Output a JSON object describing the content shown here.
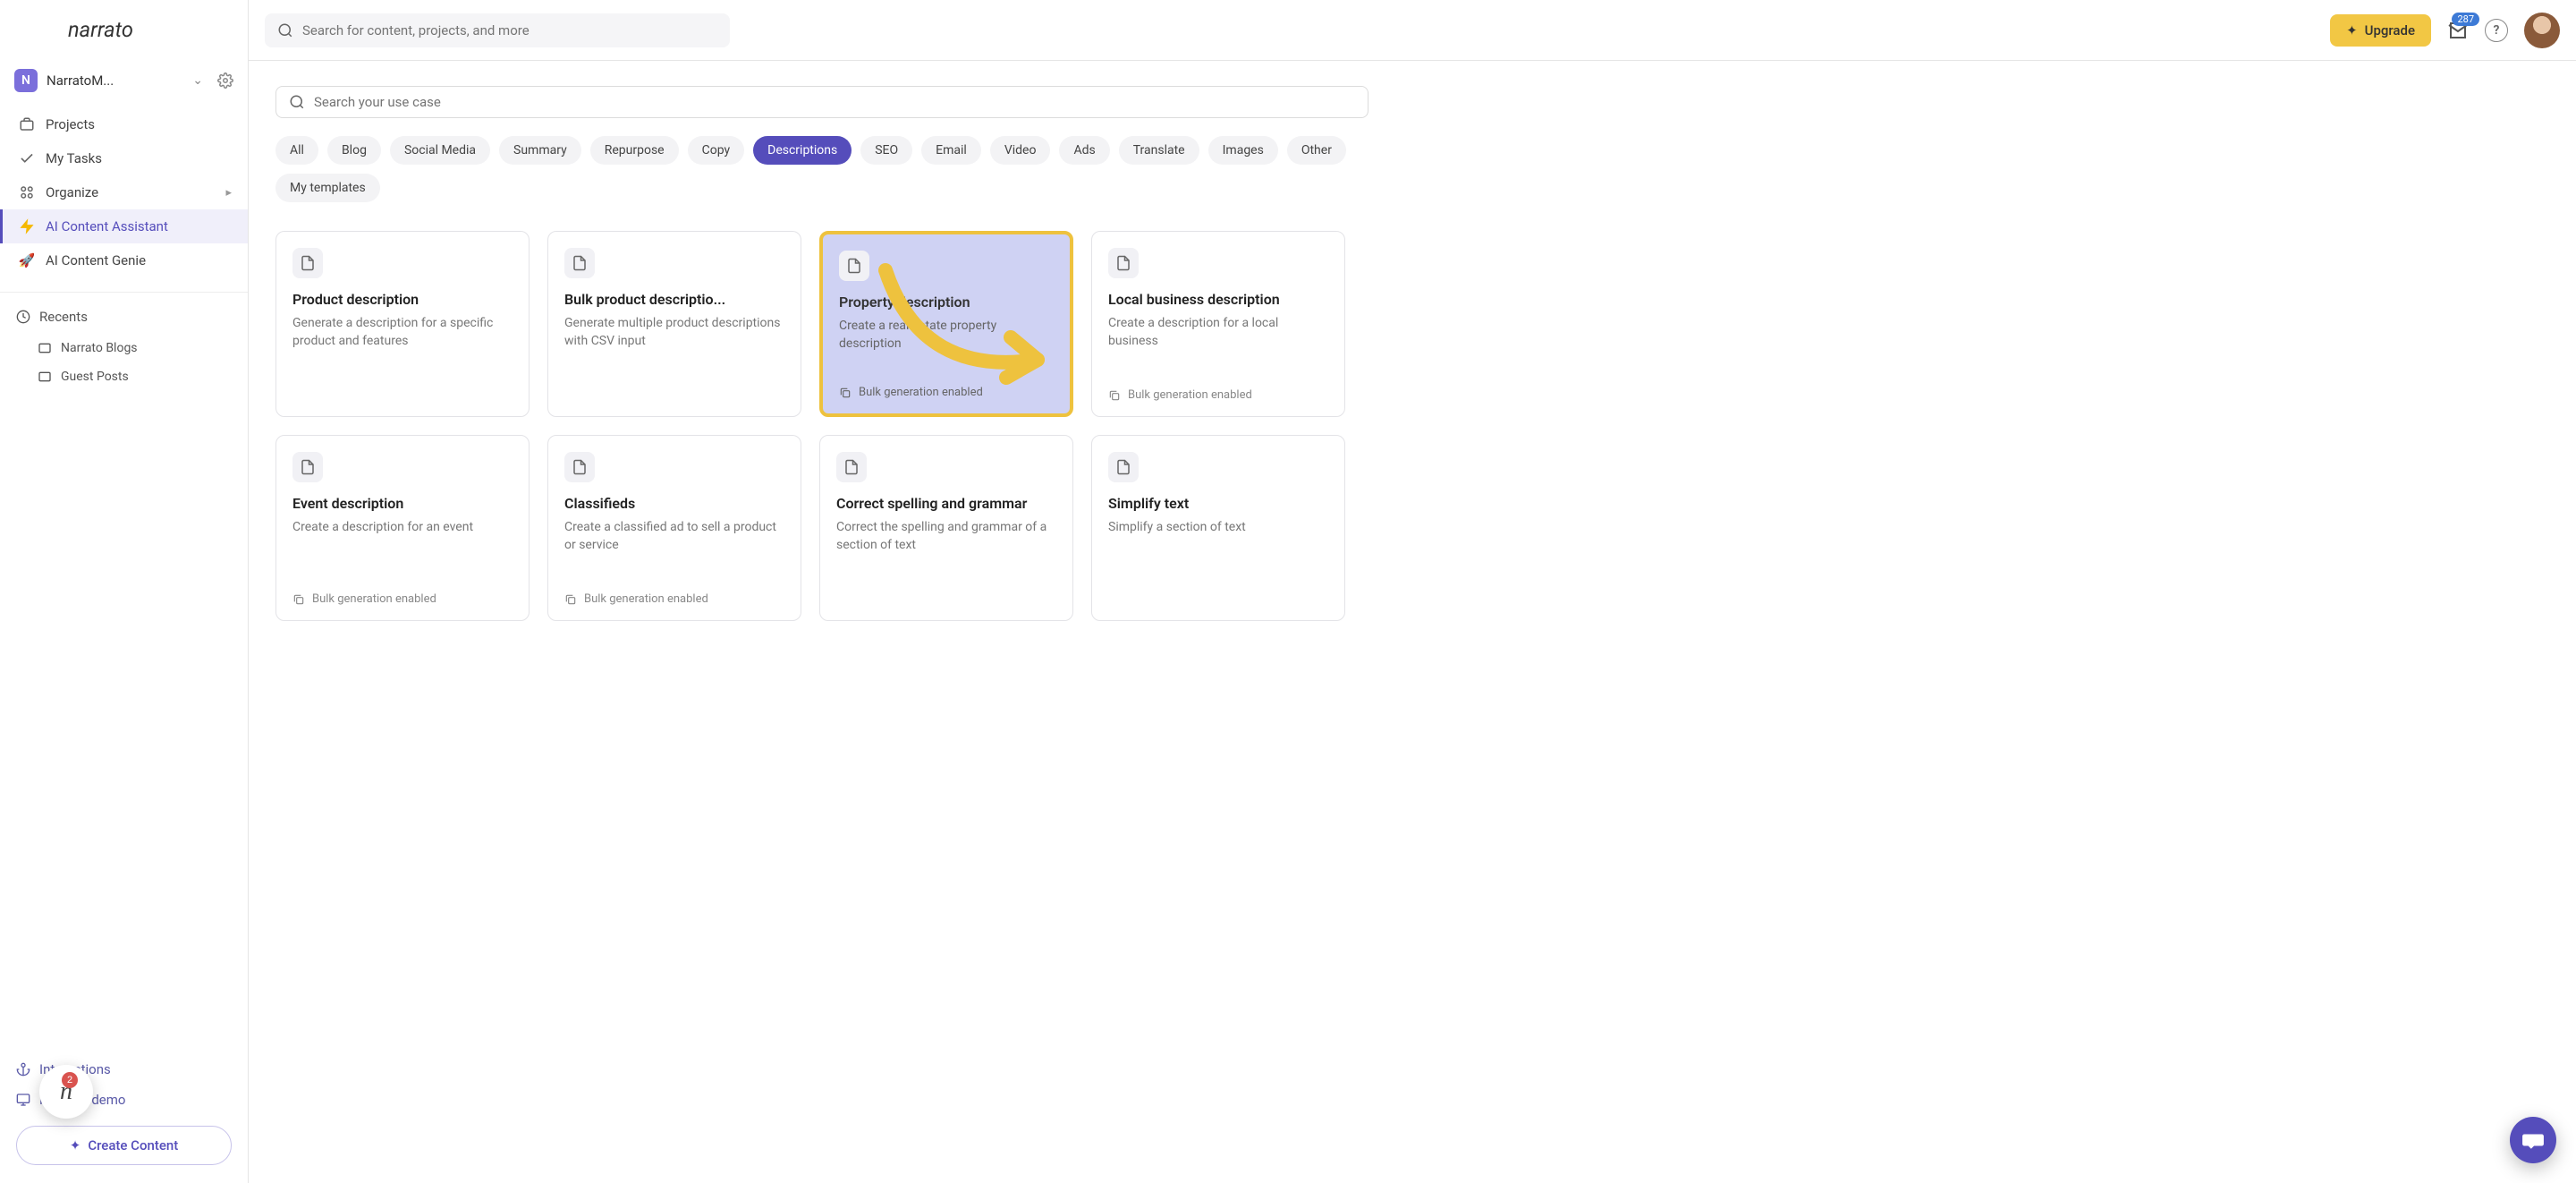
{
  "workspace": {
    "badge": "N",
    "name": "NarratoM..."
  },
  "nav": {
    "projects": "Projects",
    "my_tasks": "My Tasks",
    "organize": "Organize",
    "ai_assistant": "AI Content Assistant",
    "ai_genie": "AI Content Genie"
  },
  "recents": {
    "header": "Recents",
    "items": [
      "Narrato Blogs",
      "Guest Posts"
    ]
  },
  "bottom": {
    "integrations": "Integrations",
    "request_demo": "Request demo",
    "create_content": "Create Content"
  },
  "floating_count": "2",
  "topbar": {
    "search_placeholder": "Search for content, projects, and more",
    "upgrade": "Upgrade",
    "notif_count": "287"
  },
  "usecase_search_placeholder": "Search your use case",
  "filters": [
    "All",
    "Blog",
    "Social Media",
    "Summary",
    "Repurpose",
    "Copy",
    "Descriptions",
    "SEO",
    "Email",
    "Video",
    "Ads",
    "Translate",
    "Images",
    "Other",
    "My templates"
  ],
  "active_filter": "Descriptions",
  "bulk_label": "Bulk generation enabled",
  "cards": [
    {
      "title": "Product description",
      "desc": "Generate a description for a specific product and features",
      "bulk": false,
      "highlight": false
    },
    {
      "title": "Bulk product descriptio...",
      "desc": "Generate multiple product descriptions with CSV input",
      "bulk": false,
      "highlight": false
    },
    {
      "title": "Property description",
      "desc": "Create a real estate property description",
      "bulk": true,
      "highlight": true
    },
    {
      "title": "Local business description",
      "desc": "Create a description for a local business",
      "bulk": true,
      "highlight": false
    },
    {
      "title": "Event description",
      "desc": "Create a description for an event",
      "bulk": true,
      "highlight": false
    },
    {
      "title": "Classifieds",
      "desc": "Create a classified ad to sell a product or service",
      "bulk": true,
      "highlight": false
    },
    {
      "title": "Correct spelling and grammar",
      "desc": "Correct the spelling and grammar of a section of text",
      "bulk": false,
      "highlight": false
    },
    {
      "title": "Simplify text",
      "desc": "Simplify a section of text",
      "bulk": false,
      "highlight": false
    }
  ]
}
